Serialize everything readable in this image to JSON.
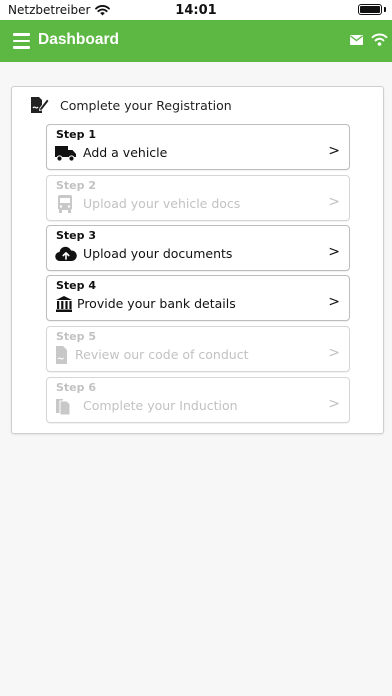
{
  "status_bar": {
    "carrier": "Netzbetreiber",
    "time": "14:01"
  },
  "header": {
    "title": "Dashboard"
  },
  "registration": {
    "title": "Complete your Registration",
    "steps": [
      {
        "label": "Step 1",
        "text": "Add a vehicle",
        "chevron": ">",
        "icon": "truck-icon",
        "enabled": true
      },
      {
        "label": "Step 2",
        "text": "Upload your vehicle docs",
        "chevron": ">",
        "icon": "bus-icon",
        "enabled": false
      },
      {
        "label": "Step 3",
        "text": "Upload your documents",
        "chevron": ">",
        "icon": "cloud-upload-icon",
        "enabled": true
      },
      {
        "label": "Step 4",
        "text": "Provide your bank details",
        "chevron": ">",
        "icon": "bank-icon",
        "enabled": true
      },
      {
        "label": "Step 5",
        "text": "Review our code of conduct",
        "chevron": ">",
        "icon": "document-icon",
        "enabled": false
      },
      {
        "label": "Step 6",
        "text": "Complete your Induction",
        "chevron": ">",
        "icon": "copy-icon",
        "enabled": false
      }
    ]
  },
  "colors": {
    "brand_green": "#5cb843",
    "disabled_text": "#c2c2c2",
    "card_border": "#cfcfcf"
  }
}
